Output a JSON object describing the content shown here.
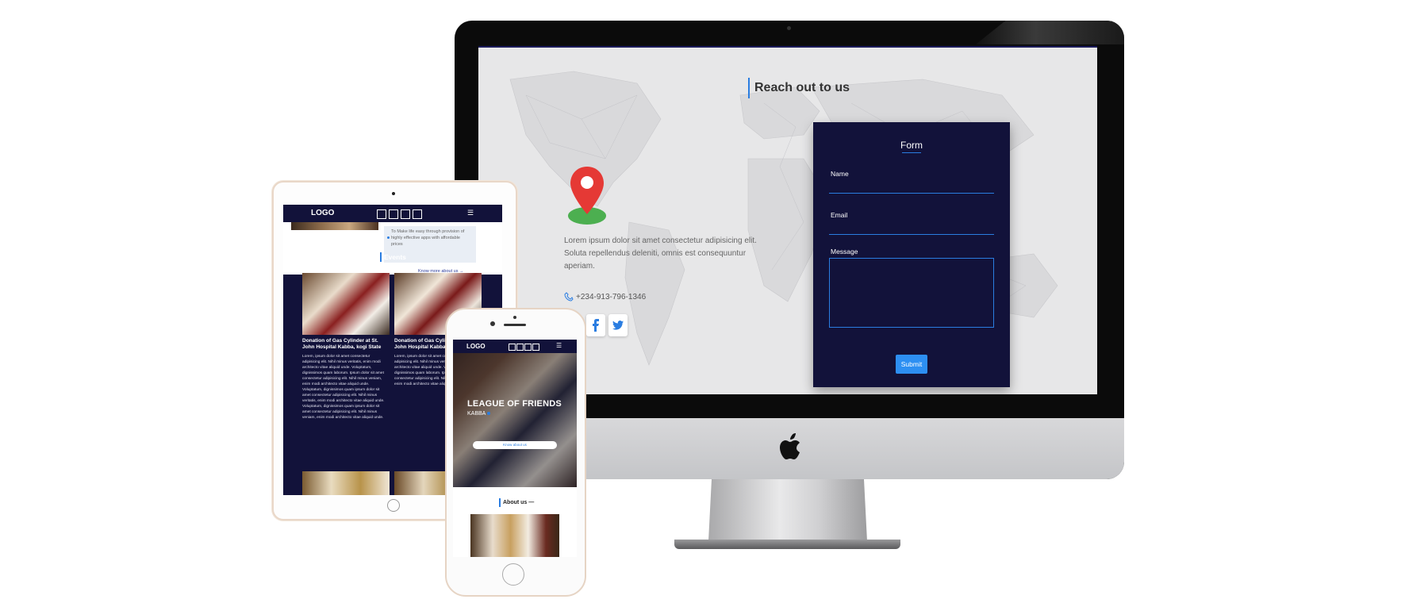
{
  "desktop": {
    "section_title": "Reach out to us",
    "description": "Lorem ipsum dolor sit amet consectetur adipisicing elit. Soluta repellendus deleniti, omnis est consequuntur aperiam.",
    "phone": "+234-913-796-1346",
    "social": [
      "facebook-icon",
      "twitter-icon"
    ],
    "form": {
      "title": "Form",
      "name_label": "Name",
      "email_label": "Email",
      "message_label": "Message",
      "submit_label": "Submit"
    },
    "colors": {
      "form_bg": "#12123a",
      "accent": "#2a7de1",
      "button": "#2d8ff2"
    }
  },
  "tablet": {
    "logo": "LOGO",
    "about_text": "To Make life easy through provision of highly effective apps with affordable prices",
    "know_more": "Know more about us →",
    "events_title": "Events",
    "events": [
      {
        "title": "Donation of Gas Cylinder at St. John Hospital Kabba, kogi State",
        "body": "Lorem, ipsum dolor sit amet consectetur adipisicing elit. Nihil minus veritatis, enim modi architecto vitae aliquid unde. Voluptatum, dignissimos quam laborum. Ipsum dolor sit amet consectetur adipisicing elit. Nihil minus veniam, enim modi architecto vitae aliquid unde. Voluptatum, dignissimos quam ipsum dolor sit amet consectetur adipisicing elit. Nihil minus veritatis, enim modi architecto vitae aliquid unde. Voluptatum, dignissimos quam ipsum dolor sit amet consectetur adipisicing elit. Nihil minus veniam, enim modi architecto vitae aliquid unde. Voluptatum, dignissimos quam."
      },
      {
        "title": "Donation of Gas Cylinder at St. John Hospital Kabba, kogi State",
        "body": "Lorem, ipsum dolor sit amet consectetur adipisicing elit. Nihil minus veritatis, enim modi architecto vitae aliquid unde. Voluptatum, dignissimos quam laborum. Ipsum dolor sit amet consectetur adipisicing elit. Nihil minus veniam, enim modi architecto vitae aliquid unde. Voluptatum, dignissimos quam."
      }
    ]
  },
  "phone": {
    "logo": "LOGO",
    "hero_title": "LEAGUE OF FRIENDS",
    "hero_sub": "KABBA",
    "hero_button": "Know about us",
    "about_title": "About us —"
  }
}
